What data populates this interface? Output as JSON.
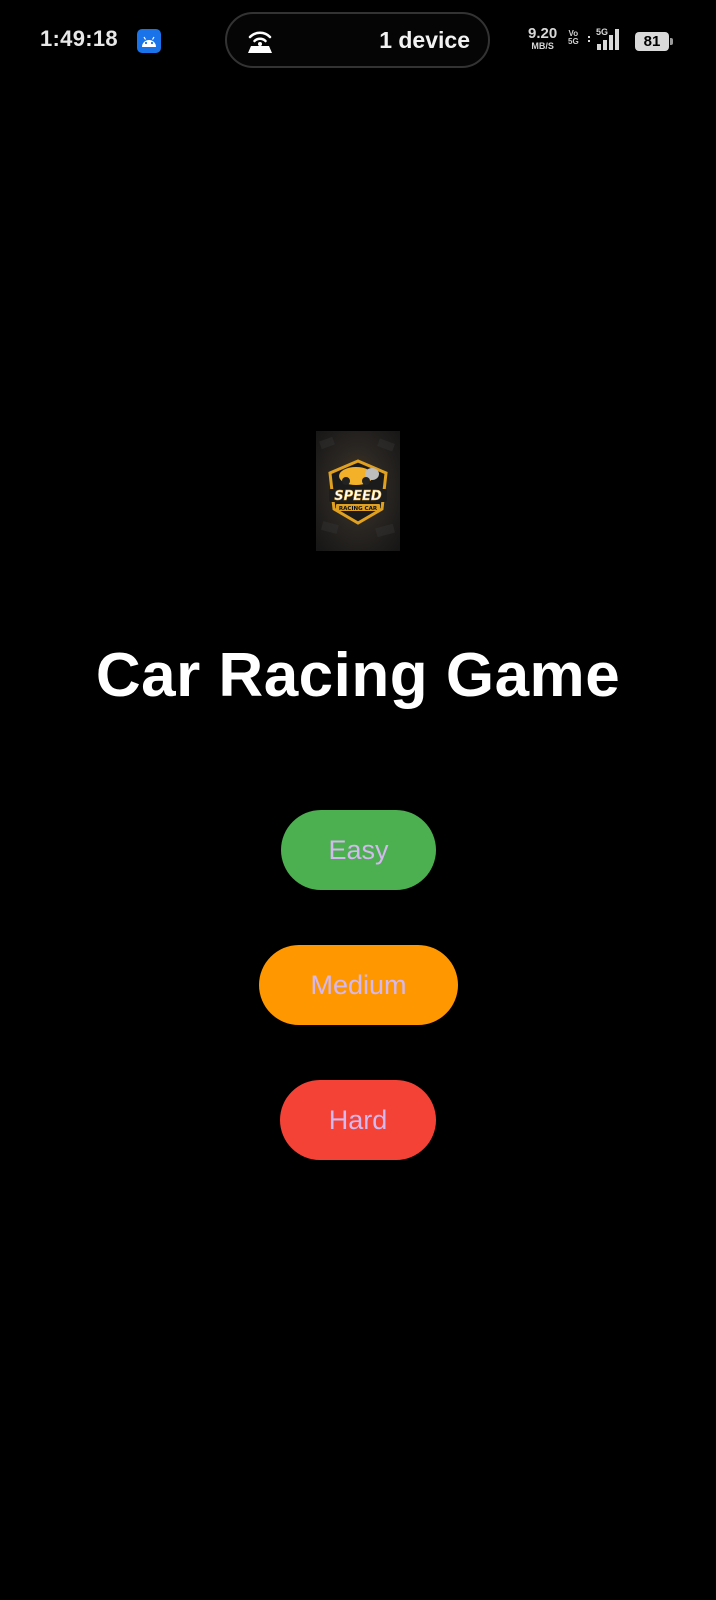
{
  "status_bar": {
    "time": "1:49:18",
    "app_icon": "android-icon",
    "hotspot_icon": "hotspot-icon",
    "device_count": "1 device",
    "net_speed_value": "9.20",
    "net_speed_unit": "MB/S",
    "volte_top": "Vo",
    "volte_bottom": "5G",
    "network_type": "5G",
    "signal_icon": "signal-bars-icon",
    "battery_level": "81"
  },
  "main": {
    "logo_icon": "speed-racing-car-logo",
    "logo_text": "SPEED",
    "logo_subtext": "RACING CAR",
    "title": "Car Racing Game",
    "buttons": {
      "easy": "Easy",
      "medium": "Medium",
      "hard": "Hard"
    }
  },
  "colors": {
    "background": "#000000",
    "easy": "#4caf50",
    "medium": "#ff9800",
    "hard": "#f44336",
    "button_text": "#d4b8f0"
  }
}
